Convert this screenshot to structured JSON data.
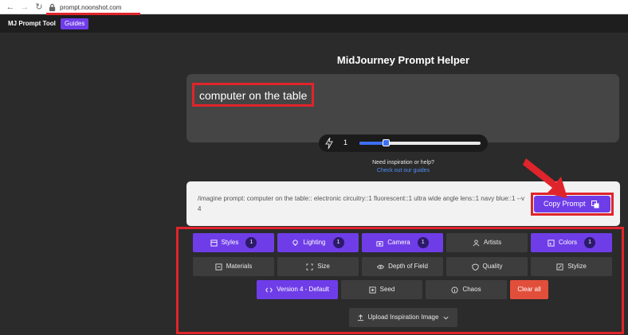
{
  "browser": {
    "url": "prompt.noonshot.com"
  },
  "app": {
    "name": "MJ Prompt Tool",
    "guides_label": "Guides"
  },
  "page": {
    "title": "MidJourney Prompt Helper"
  },
  "prompt_input": {
    "value": "computer on the table"
  },
  "slider": {
    "value": "1",
    "level": 0.22
  },
  "help": {
    "text": "Need inspiration or help?",
    "link": "Check out our guides"
  },
  "output": {
    "text": "/imagine prompt: computer on the table:: electronic circuitry::1 fluorescent::1 ultra wide angle lens::1 navy blue::1 --v 4",
    "copy_label": "Copy Prompt"
  },
  "options": {
    "row1": [
      {
        "label": "Styles",
        "count": "1"
      },
      {
        "label": "Lighting",
        "count": "1"
      },
      {
        "label": "Camera",
        "count": "1"
      },
      {
        "label": "Artists"
      },
      {
        "label": "Colors",
        "count": "1"
      }
    ],
    "row2": [
      "Materials",
      "Size",
      "Depth of Field",
      "Quality",
      "Stylize"
    ],
    "version_label": "Version 4 - Default",
    "seed_label": "Seed",
    "chaos_label": "Chaos",
    "clear_label": "Clear all",
    "upload_label": "Upload Inspiration Image"
  },
  "colors": {
    "accent": "#6f3de8",
    "danger": "#e14f3b",
    "highlight": "#e0242b"
  }
}
